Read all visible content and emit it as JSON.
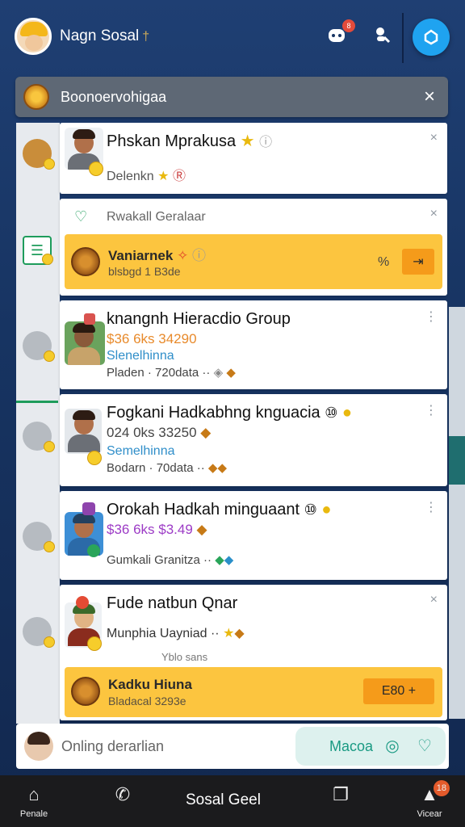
{
  "header": {
    "app_name": "Nagn Sosal",
    "app_tag": "†",
    "notif_count": "8",
    "icons": [
      "avatar",
      "bot-icon",
      "person-search-icon",
      "sync-icon"
    ]
  },
  "banner": {
    "title": "Boonoervohigaa",
    "close": "×"
  },
  "cards": [
    {
      "title": "Phskan Mprakusa",
      "sub": "Delenkn",
      "icons": [
        "star-icon",
        "badge-icon"
      ],
      "more": "×"
    },
    {
      "header": "Rwakall Geralaar",
      "close": "×",
      "cta_title": "Vaniarnek",
      "cta_sub": "blsbgd 1 B3de",
      "cta_percent": "%",
      "cta_button": "⇥"
    },
    {
      "title": "knangnh Hieracdio Group",
      "price": "$36 6ks 34290",
      "category": "Slenelhinna",
      "meta": "Pladen · 720data ··"
    },
    {
      "title": "Fogkani Hadkabhng knguacia",
      "price": "024 0ks 33250",
      "category": "Semelhinna",
      "meta": "Bodarn · 70data ··"
    },
    {
      "title": "Orokah Hadkah minguaant",
      "price": "$36 6ks $3.49",
      "meta": "Gumkali Granitza ··"
    },
    {
      "title": "Fude natbun Qnar",
      "sub": "Munphia Uayniad ··",
      "note": "Yblo sans",
      "cta_title": "Kadku Hiuna",
      "cta_sub": "Bladacal 3293e",
      "cta_button": "E80 +"
    }
  ],
  "composer": {
    "placeholder": "Onling derarlian",
    "action_label": "Macoa"
  },
  "bottom_nav": {
    "home_label": "Penale",
    "center_label": "Sosal Geel",
    "right_label": "Vicear",
    "right_badge": "18"
  }
}
